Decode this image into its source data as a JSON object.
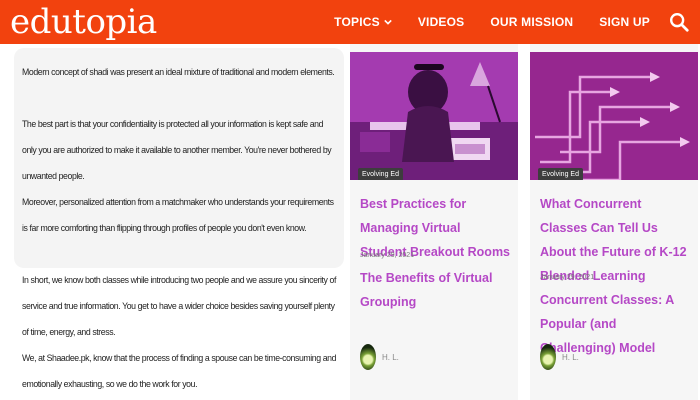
{
  "header": {
    "logo": "edutopia",
    "nav": [
      {
        "label": "TOPICS"
      },
      {
        "label": "VIDEOS"
      },
      {
        "label": "OUR MISSION"
      },
      {
        "label": "SIGN UP"
      }
    ],
    "brand_color": "#f2420e"
  },
  "article": {
    "paragraphs": [
      "Modern concept of shadi was present an ideal mixture of traditional and modern elements.",
      "The best part is that your confidentiality is protected all your information is kept safe and only you are authorized to make it available to another member. You're never bothered by unwanted people.",
      "Moreover, personalized attention from a matchmaker who understands your requirements is far more comforting than flipping through profiles of people you don't even know.",
      "In short, we know both classes while introducing two people and we assure you sincerity of service and true information. You get to have a wider choice besides saving yourself plenty of time, energy, and stress.",
      "We, at Shaadee.pk, know that the process of finding a spouse can be time-consuming and emotionally exhausting, so we do the work for you."
    ]
  },
  "cards": [
    {
      "badge": "Evolving Ed",
      "title": "Best Practices for Managing Virtual Student Breakout Rooms",
      "date": "January 29, 2021",
      "subtitle": "The Benefits of Virtual Grouping",
      "author": "H. L."
    },
    {
      "badge": "Evolving Ed",
      "title": "What Concurrent Classes Can Tell Us About the Future of K-12 Blended Learning",
      "date": "January 29, 2021",
      "subtitle": "Concurrent Classes: A Popular (and Challenging) Model",
      "author": "H. L."
    }
  ],
  "accent_color": "#b548c6"
}
